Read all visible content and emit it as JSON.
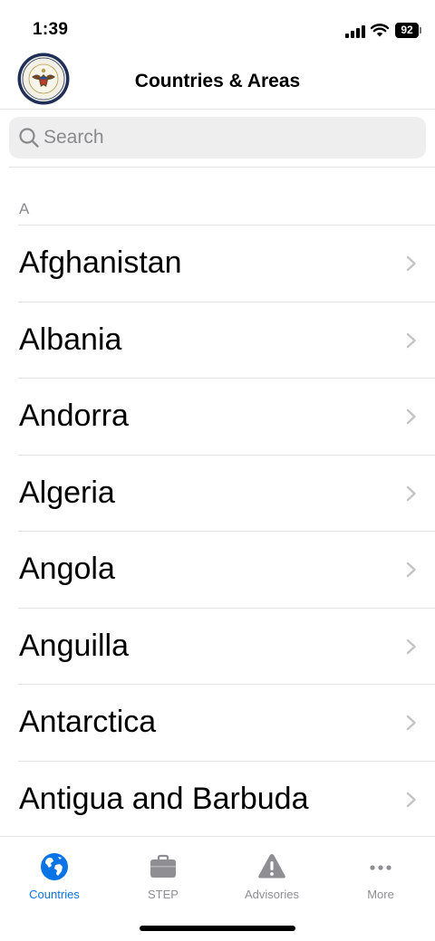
{
  "status_bar": {
    "time": "1:39",
    "battery_level": "92"
  },
  "header": {
    "title": "Countries & Areas"
  },
  "search": {
    "placeholder": "Search",
    "value": ""
  },
  "section": {
    "letter": "A"
  },
  "countries": [
    {
      "name": "Afghanistan"
    },
    {
      "name": "Albania"
    },
    {
      "name": "Andorra"
    },
    {
      "name": "Algeria"
    },
    {
      "name": "Angola"
    },
    {
      "name": "Anguilla"
    },
    {
      "name": "Antarctica"
    },
    {
      "name": "Antigua and Barbuda"
    }
  ],
  "tabs": [
    {
      "label": "Countries",
      "icon": "globe-icon",
      "active": true
    },
    {
      "label": "STEP",
      "icon": "briefcase-icon",
      "active": false
    },
    {
      "label": "Advisories",
      "icon": "warning-icon",
      "active": false
    },
    {
      "label": "More",
      "icon": "more-icon",
      "active": false
    }
  ],
  "colors": {
    "accent": "#0a74e6",
    "inactive": "#8e8e93",
    "divider": "#e3e3e6",
    "search_bg": "#eeeeef"
  }
}
